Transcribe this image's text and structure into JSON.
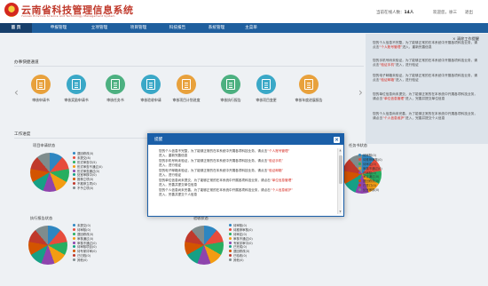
{
  "header": {
    "title": "云南省科技管理信息系统",
    "subtitle": "Yunnan Province Science and Technology Management System",
    "online_label": "当前在线人数：",
    "online_count": "14人",
    "welcome_label": "欢迎您，",
    "user_name": "徐三",
    "logout": "退出"
  },
  "nav": {
    "items": [
      "首 页",
      "申报管理",
      "立项管理",
      "项目管理",
      "科技报告",
      "系统管理",
      "主菜单"
    ]
  },
  "shortcuts": {
    "section_title": "办事快捷通道",
    "items": [
      {
        "label": "审核申请书",
        "color": "#e8a13c"
      },
      {
        "label": "审核奖励申请书",
        "color": "#3aa8c7"
      },
      {
        "label": "审核任务书",
        "color": "#4cb080"
      },
      {
        "label": "审核验收申请",
        "color": "#3aa8c7"
      },
      {
        "label": "审核项目计划进度",
        "color": "#e8a13c"
      },
      {
        "label": "审核执行报告",
        "color": "#4cb080"
      },
      {
        "label": "审核项目变更",
        "color": "#3aa8c7"
      },
      {
        "label": "审核年度进展报告",
        "color": "#e8a13c"
      }
    ],
    "prev_arrow": "‹",
    "next_arrow": "›"
  },
  "work_status": {
    "section_title": "工作进度",
    "charts": [
      {
        "title": "项目申请状态",
        "legend": [
          "退回修改(0)",
          "未提交(8)",
          "形式审查中(5)",
          "形式审查不通过(0)",
          "形式审查通过(0)",
          "处室审核中(0)",
          "推荐立项(0)",
          "不推荐立项(0)",
          "不予立项(0)"
        ],
        "colors": [
          "#2e86c1",
          "#e74c3c",
          "#27ae60",
          "#f39c12",
          "#8e44ad",
          "#16a085",
          "#d35400",
          "#c0392b",
          "#7f8c8d"
        ]
      },
      {
        "title": "任务书状态",
        "legend": [
          "待审核(0)",
          "待推荐审核(0)",
          "待审定(0)",
          "审核不通过(0)",
          "已审核(0)",
          "审定通过(0)",
          "退回修改(0)",
          "已签订(0)",
          "处室审核(0)"
        ],
        "colors": [
          "#2e86c1",
          "#e74c3c",
          "#27ae60",
          "#f39c12",
          "#8e44ad",
          "#16a085",
          "#d35400",
          "#c0392b",
          "#7f8c8d"
        ]
      },
      {
        "title": "执行报告状态",
        "legend": [
          "未提交(0)",
          "待审核(0)",
          "退回修改(0)",
          "审核通过(0)",
          "审核不通过(0)",
          "待审核项目(0)",
          "待专家评审(0)",
          "已归档(0)",
          "其他(0)"
        ],
        "colors": [
          "#2e86c1",
          "#e74c3c",
          "#27ae60",
          "#f39c12",
          "#8e44ad",
          "#16a085",
          "#d35400",
          "#c0392b",
          "#7f8c8d"
        ]
      },
      {
        "title": "验收状态",
        "legend": [
          "待审核(0)",
          "待推荐审核(0)",
          "待审定(0)",
          "审核不通过(0)",
          "专家评审中(0)",
          "已完成(0)",
          "退回修改(0)",
          "已验收(0)",
          "其他(0)"
        ],
        "colors": [
          "#2e86c1",
          "#e74c3c",
          "#27ae60",
          "#f39c12",
          "#8e44ad",
          "#16a085",
          "#d35400",
          "#c0392b",
          "#7f8c8d"
        ]
      }
    ]
  },
  "notice_panel": {
    "clear_label": "× 清除工作提醒",
    "items": [
      {
        "text": "您的个人信息不完整，为了能够正常的在本系统中开展各项科技业务，请点击",
        "hl": "“个人账号管理”",
        "tail": "进入，重新完善信息"
      },
      {
        "text": "您的手机号码未验证，为了能够正常的在本系统中开展各项科技业务，请点击",
        "hl": "“验证手机”",
        "tail": "进入，进行验证"
      },
      {
        "text": "您的电子邮箱未验证，为了能够正常的在本系统中开展各项科技业务，请点击",
        "hl": "“验证邮箱”",
        "tail": "进入，进行验证"
      },
      {
        "text": "您的单位信息尚未提交，为了能够正常的在本系统中开展各项科技业务，请点击",
        "hl": "“单位信息管理”",
        "tail": "进入，完善并提交单位信息"
      },
      {
        "text": "您的个人信息尚未完善，为了能够正常的在本系统中开展各项科技业务，请点击",
        "hl": "“个人信息维护”",
        "tail": "进入，完善并提交个人信息"
      }
    ]
  },
  "modal": {
    "title": "提醒",
    "close": "×",
    "lines": [
      {
        "text": "您的个人信息不完整，为了能够正常的在本系统中开展各项科技业务，请点击",
        "hl": "“个人账号管理”",
        "tail": "进入，重新完善信息"
      },
      {
        "text": "您的手机号码未验证，为了能够正常的在本系统中开展各项科技业务，请点击",
        "hl": "“验证手机”",
        "tail": "进入，进行验证"
      },
      {
        "text": "您的电子邮箱未验证，为了能够正常的在本系统中开展各项科技业务，请点击",
        "hl": "“验证邮箱”",
        "tail": "进入，进行验证"
      },
      {
        "text": "您的单位信息尚未提交，为了能够正常的在本系统中开展各项科技业务，请点击",
        "hl": "“单位信息管理”",
        "tail": "进入，完善并提交单位信息"
      },
      {
        "text": "您的个人信息尚未完善，为了能够正常的在本系统中开展各项科技业务，请点击",
        "hl": "“个人信息维护”",
        "tail": "进入，完善并提交个人信息"
      }
    ]
  }
}
